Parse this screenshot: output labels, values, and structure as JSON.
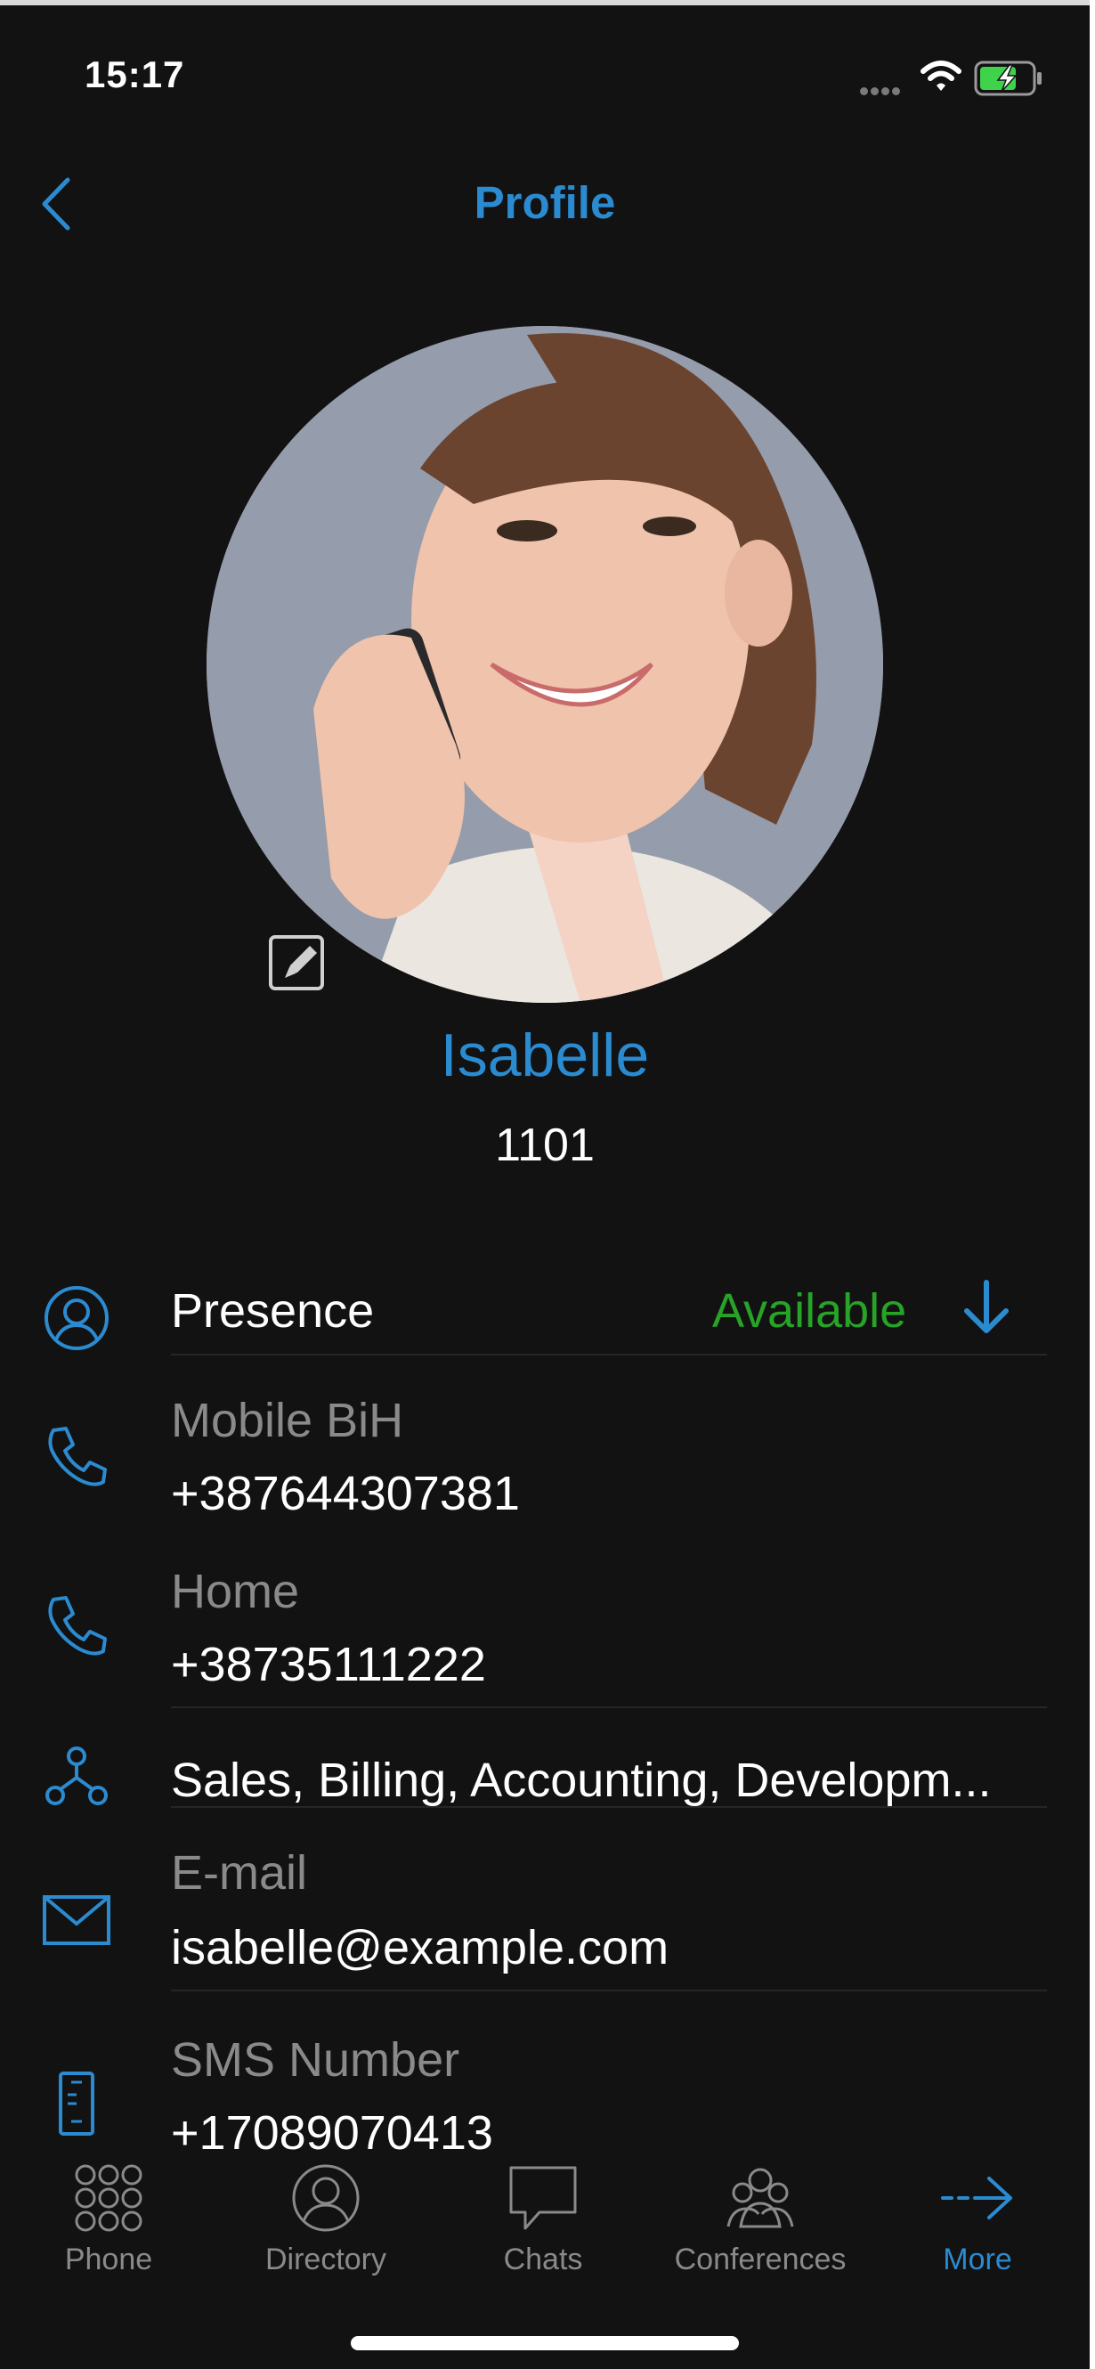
{
  "status": {
    "time": "15:17"
  },
  "nav": {
    "title": "Profile"
  },
  "profile": {
    "name": "Isabelle",
    "extension": "1101"
  },
  "rows": {
    "presence": {
      "label": "Presence",
      "value": "Available"
    },
    "mobile": {
      "label": "Mobile BiH",
      "value": "+387644307381"
    },
    "home": {
      "label": "Home",
      "value": "+38735111222"
    },
    "departments": {
      "value": "Sales, Billing, Accounting, Developm..."
    },
    "email": {
      "label": "E-mail",
      "value": "isabelle@example.com"
    },
    "sms": {
      "label": "SMS Number",
      "value": "+17089070413"
    }
  },
  "tabs": [
    {
      "label": "Phone",
      "icon": "keypad-icon"
    },
    {
      "label": "Directory",
      "icon": "person-circle-icon"
    },
    {
      "label": "Chats",
      "icon": "chat-bubble-icon"
    },
    {
      "label": "Conferences",
      "icon": "group-icon"
    },
    {
      "label": "More",
      "icon": "arrow-right-icon"
    }
  ],
  "colors": {
    "accent": "#2b8bd1",
    "available": "#27a327",
    "background": "#121212",
    "secondary_text": "#8a8a8a"
  }
}
